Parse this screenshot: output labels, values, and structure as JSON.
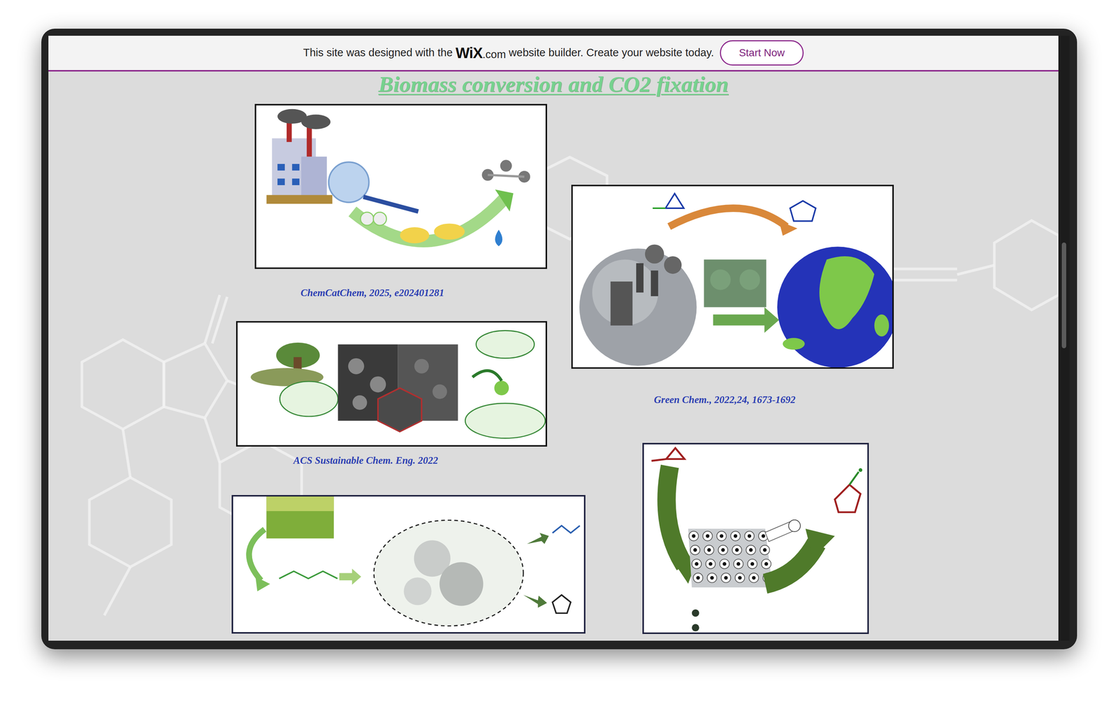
{
  "banner": {
    "text_before": "This site was designed with the",
    "logo": "WiX",
    "logo_suffix": ".com",
    "text_after": "website builder. Create your website today.",
    "button": "Start Now"
  },
  "page": {
    "title": "Biomass conversion and CO2 fixation"
  },
  "figures": [
    {
      "kind": "factory",
      "caption": "ChemCatChem, 2025, e202401281"
    },
    {
      "kind": "globes",
      "caption": "Green Chem., 2022,24, 1673-1692"
    },
    {
      "kind": "porous",
      "caption": "ACS Sustainable Chem. Eng. 2022"
    },
    {
      "kind": "biomass",
      "caption": ""
    },
    {
      "kind": "cycloaddition",
      "caption": ""
    }
  ]
}
